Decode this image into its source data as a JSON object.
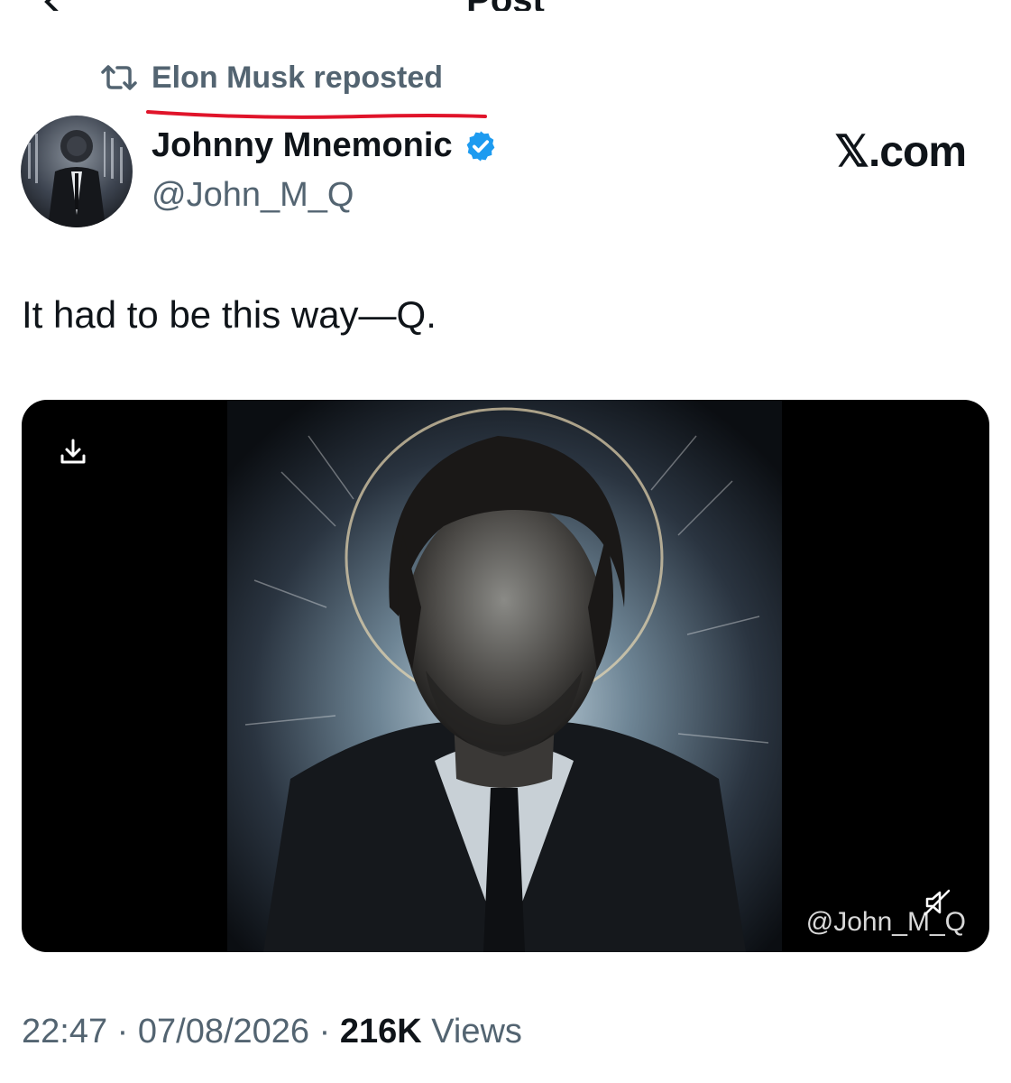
{
  "header": {
    "title": "Post",
    "back_icon": "back-arrow-icon"
  },
  "repost": {
    "icon": "repost-icon",
    "text": "Elon Musk reposted",
    "underline_color": "#e0142a"
  },
  "author": {
    "name": "Johnny Mnemonic",
    "handle": "@John_M_Q",
    "verified_icon": "verified-badge-icon",
    "verified_color": "#1d9bf0"
  },
  "watermark": "𝕏.com",
  "post": {
    "text": "It had to be this way—Q."
  },
  "media": {
    "type": "video",
    "download_icon": "download-icon",
    "mute_icon": "muted-speaker-icon",
    "watermark": "@John_M_Q"
  },
  "meta": {
    "time": "22:47",
    "separator": "·",
    "date": "07/08/2026",
    "views_count": "216K",
    "views_label": "Views"
  },
  "colors": {
    "text": "#0f1419",
    "secondary": "#536471",
    "accent": "#1d9bf0"
  }
}
